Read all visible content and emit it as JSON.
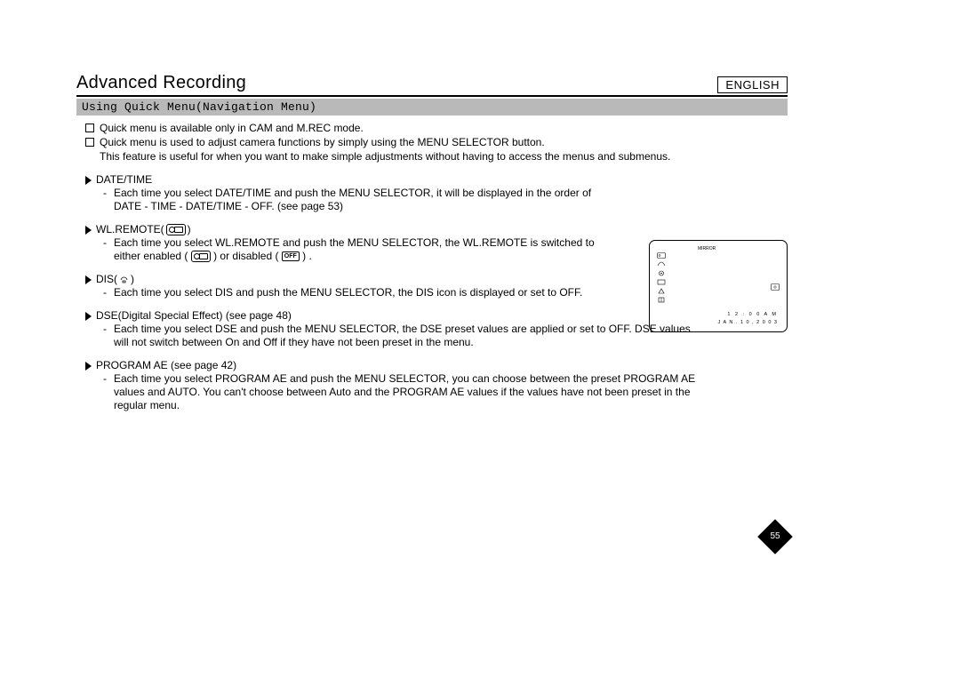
{
  "language_label": "ENGLISH",
  "title": "Advanced Recording",
  "subtitle": "Using Quick Menu(Navigation Menu)",
  "intro": [
    "Quick menu is available only in CAM and M.REC mode.",
    "Quick menu is used to adjust camera functions by simply using the MENU SELECTOR button.",
    "This feature is useful for when you want to make simple adjustments without having to access the menus and submenus."
  ],
  "sections": [
    {
      "key": "datetime",
      "heading": "DATE/TIME",
      "bullets": [
        "Each time you select DATE/TIME and push the MENU SELECTOR, it will be displayed in the order of DATE - TIME - DATE/TIME - OFF. (see page 53)"
      ]
    },
    {
      "key": "wlremote",
      "heading": "WL.REMOTE(",
      "heading_suffix": ")",
      "bullets_pre": "Each time you select WL.REMOTE and push the MENU SELECTOR, the WL.REMOTE is switched to either enabled (",
      "bullets_mid": ") or disabled (",
      "bullets_post": ") ."
    },
    {
      "key": "dis",
      "heading": "DIS(",
      "heading_suffix": ")",
      "bullets": [
        "Each time you select DIS and push the MENU SELECTOR, the DIS icon is displayed or set to OFF."
      ]
    },
    {
      "key": "dse",
      "heading": "DSE(Digital Special Effect) (see page 48)",
      "bullets": [
        "Each time you select DSE and push the MENU SELECTOR, the DSE preset values are applied or set to OFF. DSE values will not switch between On and Off if they have not been preset in the menu."
      ]
    },
    {
      "key": "programae",
      "heading": "PROGRAM AE (see page 42)",
      "bullets": [
        "Each time you select PROGRAM AE and push the MENU SELECTOR, you can choose between the preset PROGRAM AE values and AUTO. You can't choose between Auto and the PROGRAM AE values if the values have not been preset in the regular menu."
      ]
    }
  ],
  "off_label": "OFF",
  "display": {
    "mirror": "MIRROR",
    "time": "1 2 : 0 0 A M",
    "date": "J A N . 1 0 , 2 0 0 3"
  },
  "page_number": "55"
}
